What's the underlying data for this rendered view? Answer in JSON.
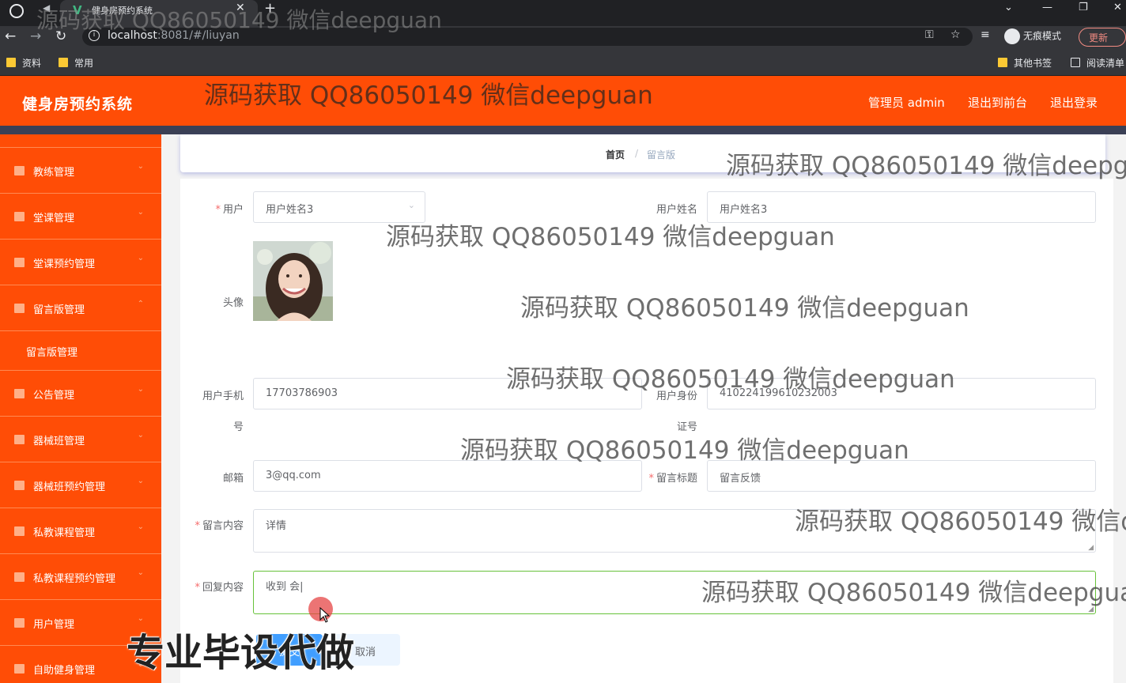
{
  "browser": {
    "tab_title": "健身房预约系统",
    "url_host": "localhost",
    "url_rest": ":8081/#/liuyan",
    "profile_label": "无痕模式",
    "update_label": "更新",
    "bookmarks": [
      "资料",
      "常用"
    ],
    "bookmarks_right": [
      "其他书签",
      "阅读清单"
    ]
  },
  "header": {
    "title": "健身房预约系统",
    "user_label": "管理员 admin",
    "front_link": "退出到前台",
    "logout_link": "退出登录",
    "bg_color": "#ff4d06"
  },
  "sidebar": {
    "items": [
      {
        "label": "教练管理"
      },
      {
        "label": "堂课管理"
      },
      {
        "label": "堂课预约管理"
      },
      {
        "label": "留言版管理"
      },
      {
        "label": "留言版管理",
        "submenu": true
      },
      {
        "label": "公告管理"
      },
      {
        "label": "器械班管理"
      },
      {
        "label": "器械班预约管理"
      },
      {
        "label": "私教课程管理"
      },
      {
        "label": "私教课程预约管理"
      },
      {
        "label": "用户管理"
      },
      {
        "label": "自助健身管理"
      }
    ]
  },
  "breadcrumb": {
    "home": "首页",
    "sep": "/",
    "current": "留言版"
  },
  "form": {
    "user_label": "用户",
    "user_value": "用户姓名3",
    "username_label": "用户姓名",
    "username_value": "用户姓名3",
    "avatar_label": "头像",
    "phone_label_1": "用户手机",
    "phone_label_2": "号",
    "phone_value": "17703786903",
    "idcard_label_1": "用户身份",
    "idcard_label_2": "证号",
    "idcard_value": "410224199610232003",
    "email_label": "邮箱",
    "email_value": "3@qq.com",
    "title_label": "留言标题",
    "title_value": "留言反馈",
    "content_label": "留言内容",
    "content_value": "详情",
    "reply_label": "回复内容",
    "reply_value": "收到  会|",
    "submit_label": "提交",
    "cancel_label": "取消"
  },
  "overlay": {
    "watermark": "源码获取 QQ86050149 微信deepguan",
    "promo": "专业毕设代做"
  }
}
